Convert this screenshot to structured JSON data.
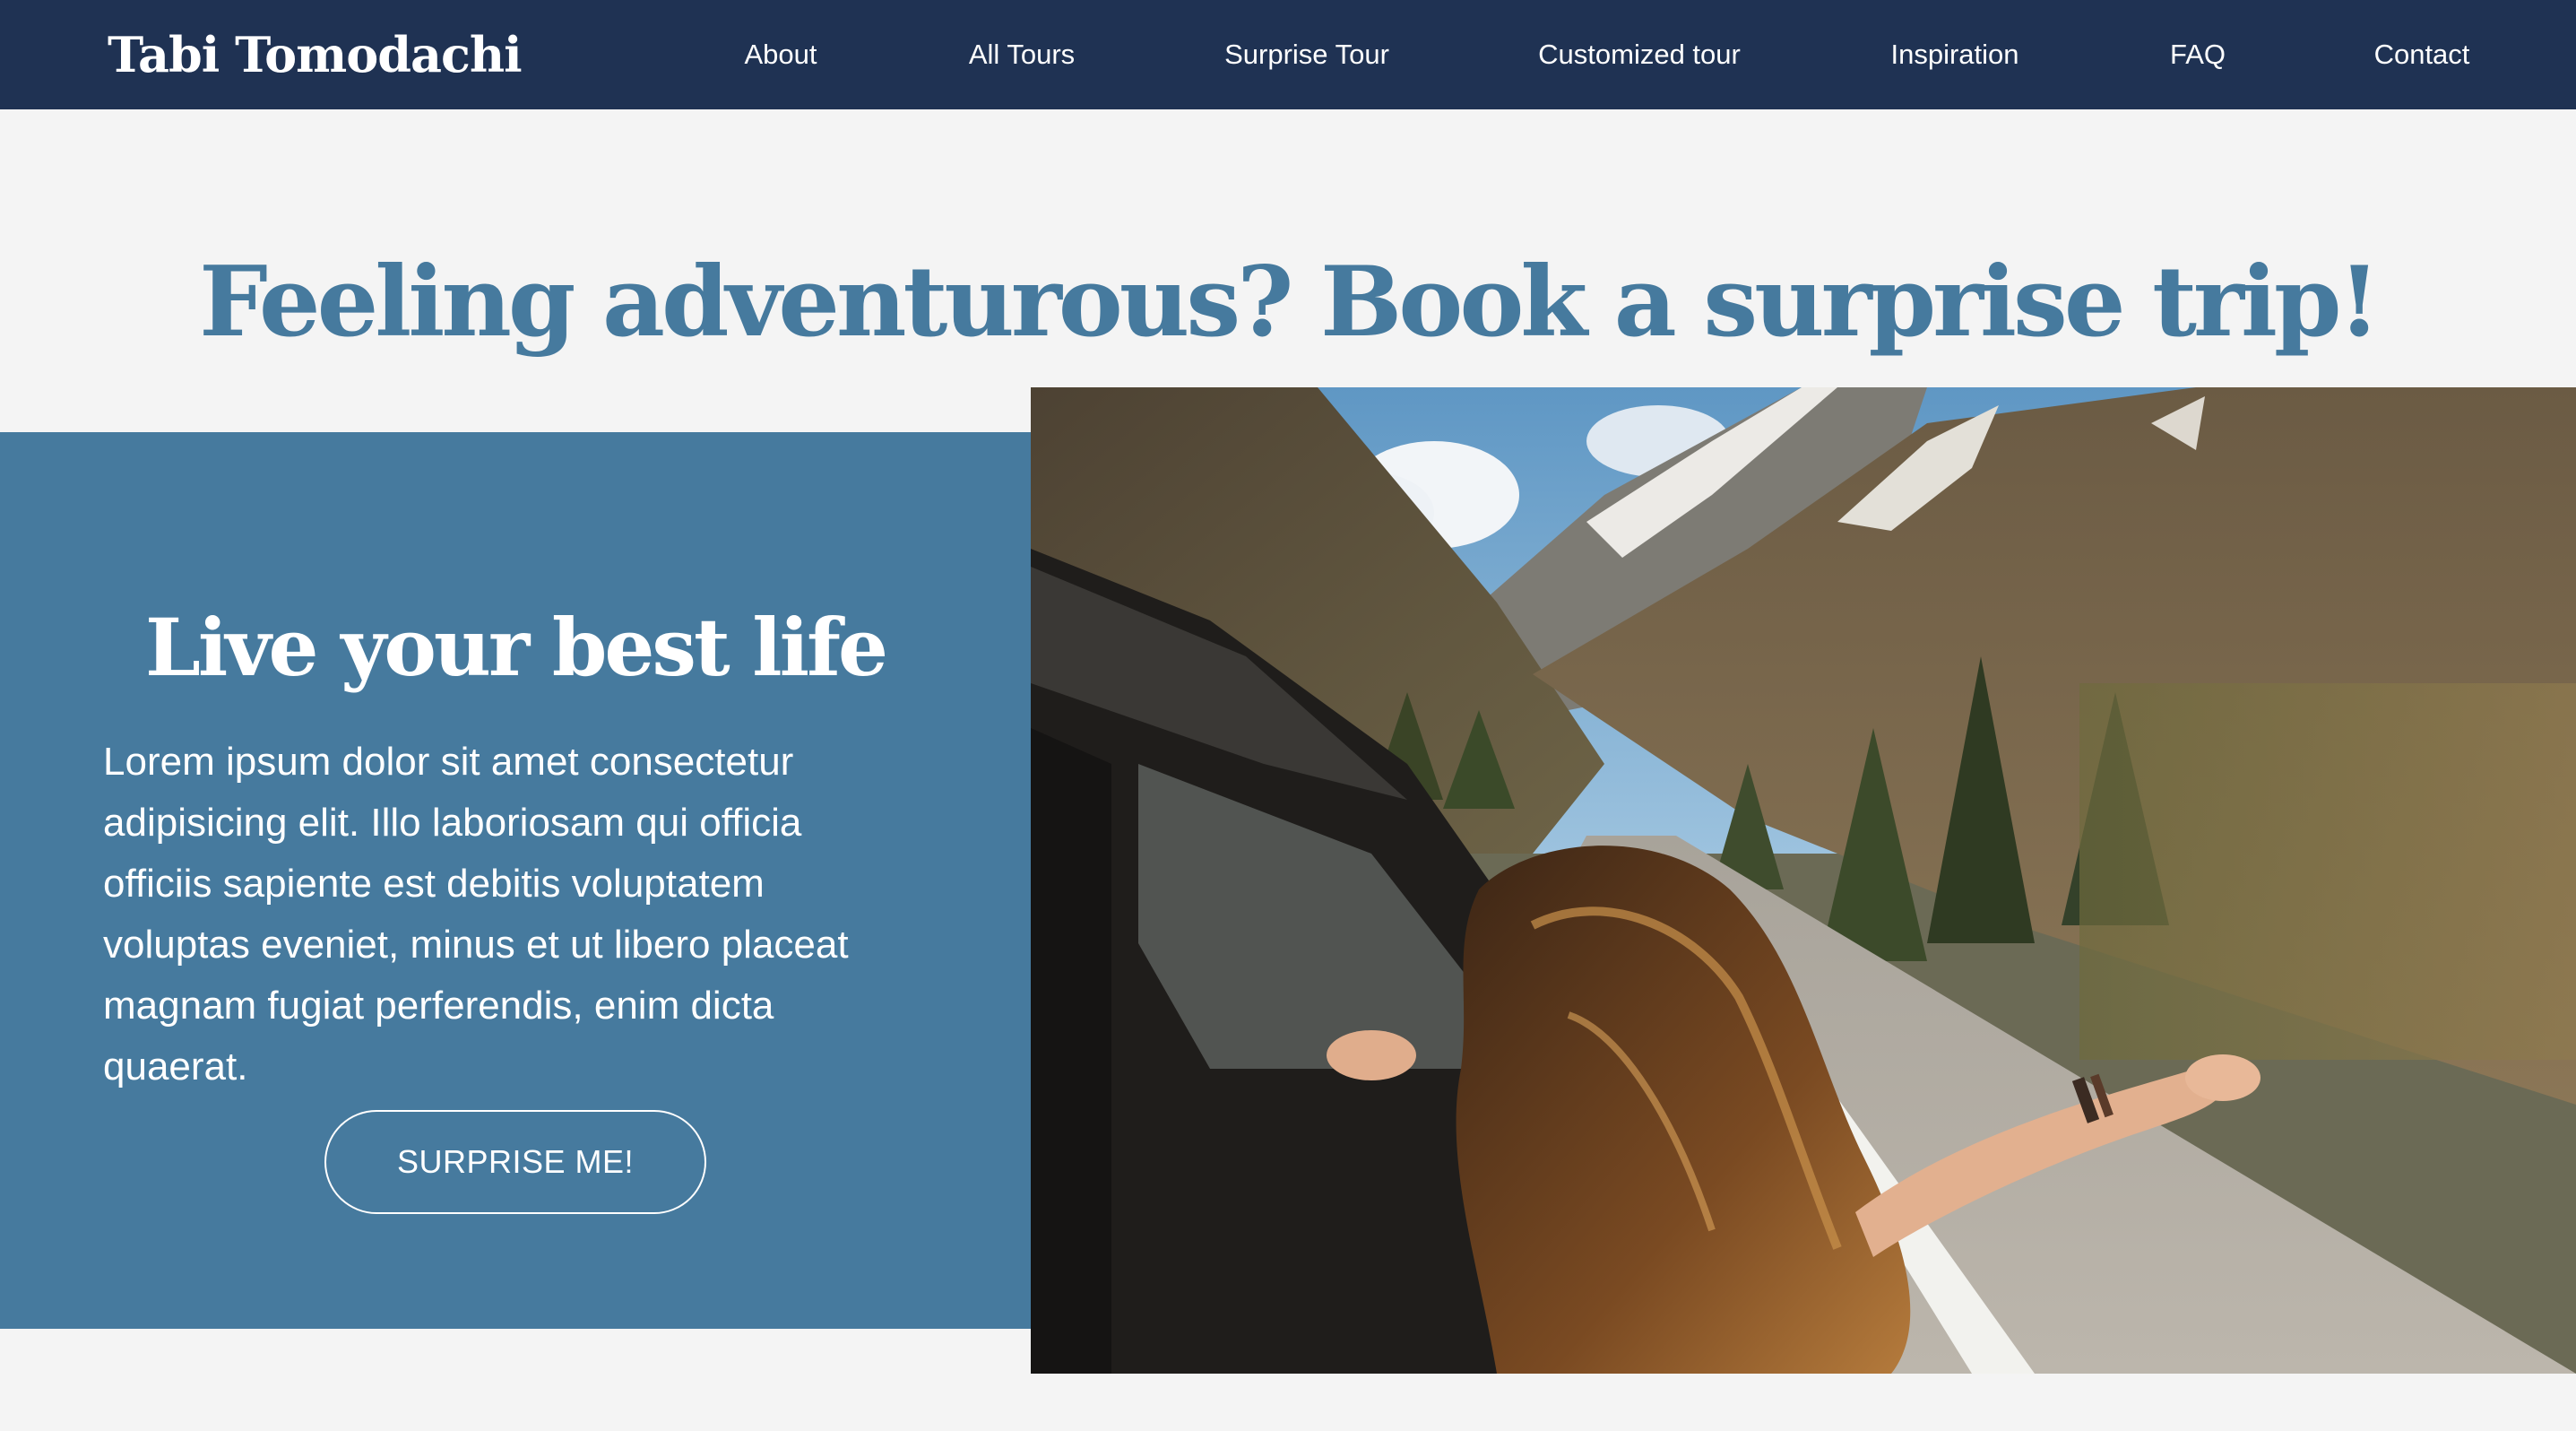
{
  "brand": {
    "name": "Tabi Tomodachi"
  },
  "nav": {
    "items": [
      {
        "label": "About"
      },
      {
        "label": "All Tours"
      },
      {
        "label": "Surprise Tour"
      },
      {
        "label": "Customized tour"
      },
      {
        "label": "Inspiration"
      },
      {
        "label": "FAQ"
      },
      {
        "label": "Contact"
      }
    ]
  },
  "hero": {
    "headline": "Feeling adventurous? Book a surprise trip!",
    "panel_title": "Live your best life",
    "panel_text": "Lorem ipsum dolor sit amet consectetur adipisicing elit. Illo laboriosam qui officia officiis sapiente est debitis voluptatem voluptas eveniet, minus et ut libero placeat magnam fugiat perferendis, enim dicta quaerat.",
    "cta_label": "SURPRISE ME!"
  },
  "colors": {
    "navbar_bg": "#1f3253",
    "accent_blue": "#467a9e",
    "page_bg": "#f4f4f4",
    "text_light": "#ffffff"
  },
  "icons": {
    "photo": "road-trip-photo"
  }
}
